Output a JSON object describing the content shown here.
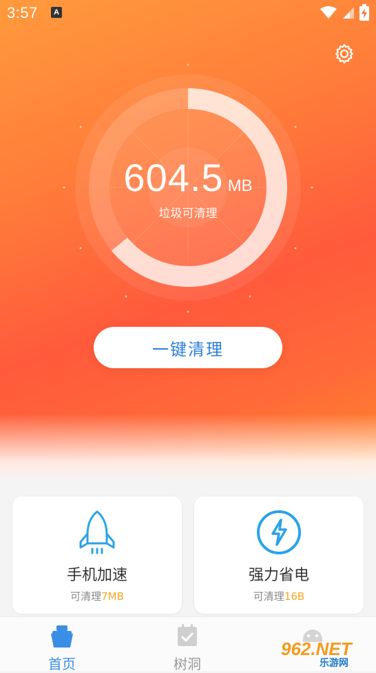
{
  "status_bar": {
    "time": "3:57",
    "notification_glyph": "A",
    "icons": [
      "wifi-icon",
      "signal-icon",
      "battery-charging-icon"
    ]
  },
  "header": {
    "settings_icon": "gear-icon"
  },
  "gauge": {
    "value": "604.5",
    "unit": "MB",
    "caption": "垃圾可清理",
    "fill_fraction": 0.64
  },
  "actions": {
    "clean_button_label": "一键清理"
  },
  "cards": [
    {
      "icon": "rocket-icon",
      "title": "手机加速",
      "sub_prefix": "可清理",
      "sub_value": "7MB"
    },
    {
      "icon": "lightning-icon",
      "title": "强力省电",
      "sub_prefix": "可清理",
      "sub_value": "16B"
    }
  ],
  "tabbar": {
    "tabs": [
      {
        "label": "首页",
        "icon": "home-icon",
        "active": true
      },
      {
        "label": "树洞",
        "icon": "calendar-check-icon",
        "active": false
      },
      {
        "label": "",
        "icon": "android-icon",
        "active": false
      }
    ]
  },
  "watermark": {
    "text_top": "962.NET",
    "text_bottom": "乐游网"
  },
  "colors": {
    "accent_blue": "#2b7ed8",
    "highlight_orange": "#f5a623",
    "hero_orange": "#ff6a38"
  }
}
